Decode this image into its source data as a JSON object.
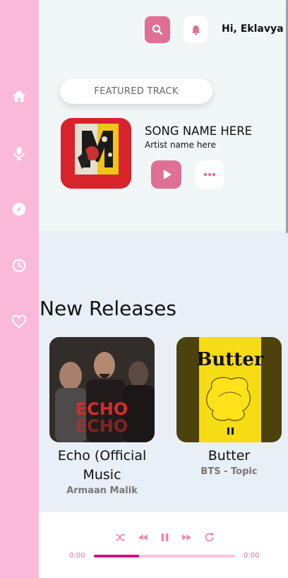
{
  "sidebar": {
    "items": [
      {
        "icon": "home-icon"
      },
      {
        "icon": "microphone-icon"
      },
      {
        "icon": "compass-icon"
      },
      {
        "icon": "clock-icon"
      },
      {
        "icon": "heart-icon"
      }
    ],
    "background": "#fbb9da"
  },
  "header": {
    "greeting": "Hi, Eklavya",
    "search_icon": "search-icon",
    "bell_icon": "bell-icon"
  },
  "featured": {
    "label": "FEATURED TRACK",
    "song_name": "SONG NAME HERE",
    "artist": "Artist name here",
    "play_icon": "play-icon",
    "more_icon": "more-icon"
  },
  "new_releases": {
    "title": "New Releases",
    "items": [
      {
        "title": "Echo (Official Music",
        "artist": "Armaan Malik",
        "art_text": "ECHO"
      },
      {
        "title": "Butter",
        "artist": "BTS - Topic",
        "art_text": "Butter"
      }
    ]
  },
  "player": {
    "time_current": "0:00",
    "time_total": "0:00",
    "progress": 0.32,
    "controls": [
      "shuffle-icon",
      "rewind-icon",
      "pause-icon",
      "fast-forward-icon",
      "repeat-icon"
    ]
  },
  "colors": {
    "accent": "#df7093",
    "progress_fill": "#d1157a",
    "progress_track": "#f8c6dc"
  }
}
